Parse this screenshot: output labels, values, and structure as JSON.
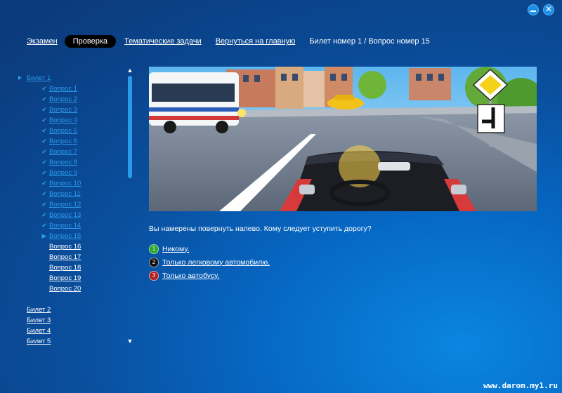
{
  "window": {
    "controls": [
      "minimize-icon",
      "close-icon"
    ]
  },
  "nav": {
    "exam": "Экзамен",
    "check": "Проверка",
    "thematic": "Тематические задачи",
    "home": "Вернуться на главную",
    "breadcrumb": "Билет номер 1 / Вопрос номер 15"
  },
  "sidebar": {
    "ticket1": "Билет 1",
    "questions": [
      {
        "label": "Вопрос 1",
        "state": "done"
      },
      {
        "label": "Вопрос 2",
        "state": "done"
      },
      {
        "label": "Вопрос 3",
        "state": "done"
      },
      {
        "label": "Вопрос 4",
        "state": "done"
      },
      {
        "label": "Вопрос 5",
        "state": "done"
      },
      {
        "label": "Вопрос 6",
        "state": "done"
      },
      {
        "label": "Вопрос 7",
        "state": "done"
      },
      {
        "label": "Вопрос 8",
        "state": "done"
      },
      {
        "label": "Вопрос 9",
        "state": "done"
      },
      {
        "label": "Вопрос 10",
        "state": "done"
      },
      {
        "label": "Вопрос 11",
        "state": "done"
      },
      {
        "label": "Вопрос 12",
        "state": "done"
      },
      {
        "label": "Вопрос 13",
        "state": "done"
      },
      {
        "label": "Вопрос 14",
        "state": "done"
      },
      {
        "label": "Вопрос 15",
        "state": "current"
      },
      {
        "label": "Вопрос 16",
        "state": "pending"
      },
      {
        "label": "Вопрос 17",
        "state": "pending"
      },
      {
        "label": "Вопрос 18",
        "state": "pending"
      },
      {
        "label": "Вопрос 19",
        "state": "pending"
      },
      {
        "label": "Вопрос 20",
        "state": "pending"
      }
    ],
    "tickets": [
      "Билет 2",
      "Билет 3",
      "Билет 4",
      "Билет 5"
    ],
    "scroll": {
      "up": "▲",
      "down": "▼"
    }
  },
  "question": {
    "text": "Вы намерены повернуть налево. Кому следует уступить дорогу?",
    "answers": [
      {
        "num": "1",
        "label": "Никому.",
        "color": "#2aa52a"
      },
      {
        "num": "2",
        "label": "Только легковому автомобилю.",
        "color": "#111111"
      },
      {
        "num": "3",
        "label": "Только автобусу.",
        "color": "#b01e1e"
      }
    ]
  },
  "watermark": "www.darom.my1.ru",
  "colors": {
    "accent": "#2a9bea",
    "active_pill": "#000000"
  }
}
